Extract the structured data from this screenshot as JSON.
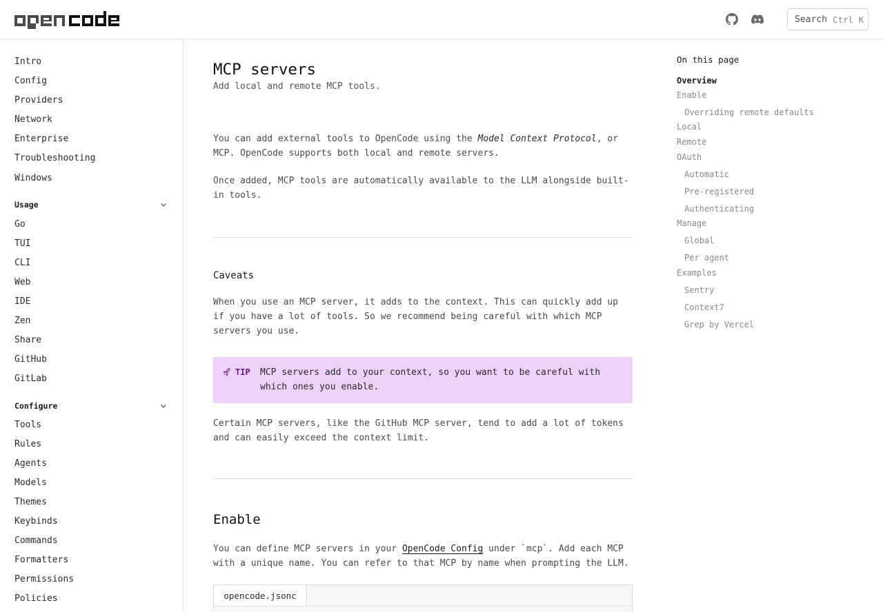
{
  "header": {
    "logo_text": "opencode",
    "search": {
      "label": "Search",
      "shortcut": "Ctrl K"
    }
  },
  "sidebar": {
    "top_items": [
      "Intro",
      "Config",
      "Providers",
      "Network",
      "Enterprise",
      "Troubleshooting",
      "Windows"
    ],
    "groups": [
      {
        "label": "Usage",
        "items": [
          "Go",
          "TUI",
          "CLI",
          "Web",
          "IDE",
          "Zen",
          "Share",
          "GitHub",
          "GitLab"
        ]
      },
      {
        "label": "Configure",
        "items": [
          "Tools",
          "Rules",
          "Agents",
          "Models",
          "Themes",
          "Keybinds",
          "Commands",
          "Formatters",
          "Permissions",
          "Policies"
        ]
      }
    ]
  },
  "main": {
    "title": "MCP servers",
    "subtitle": "Add local and remote MCP tools.",
    "intro_p1_before": "You can add external tools to OpenCode using the ",
    "intro_p1_em": "Model Context Protocol",
    "intro_p1_after": ", or MCP. OpenCode supports both local and remote servers.",
    "intro_p2": "Once added, MCP tools are automatically available to the LLM alongside built-in tools.",
    "caveats_heading": "Caveats",
    "caveats_p1": "When you use an MCP server, it adds to the context. This can quickly add up if you have a lot of tools. So we recommend being careful with which MCP servers you use.",
    "tip_label": "TIP",
    "tip_text": "MCP servers add to your context, so you want to be careful with which ones you enable.",
    "caveats_p2": "Certain MCP servers, like the GitHub MCP server, tend to add a lot of tokens and can easily exceed the context limit.",
    "enable_heading": "Enable",
    "enable_p_before": "You can define MCP servers in your ",
    "enable_p_link": "OpenCode Config",
    "enable_p_after": " under `mcp`. Add each MCP with a unique name. You can refer to that MCP by name when prompting the LLM.",
    "code_tab": "opencode.jsonc"
  },
  "toc": {
    "title": "On this page",
    "items": [
      {
        "label": "Overview",
        "indent": 0,
        "active": true
      },
      {
        "label": "Enable",
        "indent": 0,
        "active": false
      },
      {
        "label": "Overriding remote defaults",
        "indent": 1,
        "active": false
      },
      {
        "label": "Local",
        "indent": 0,
        "active": false
      },
      {
        "label": "Remote",
        "indent": 0,
        "active": false
      },
      {
        "label": "OAuth",
        "indent": 0,
        "active": false
      },
      {
        "label": "Automatic",
        "indent": 1,
        "active": false
      },
      {
        "label": "Pre-registered",
        "indent": 1,
        "active": false
      },
      {
        "label": "Authenticating",
        "indent": 1,
        "active": false
      },
      {
        "label": "Manage",
        "indent": 0,
        "active": false
      },
      {
        "label": "Global",
        "indent": 1,
        "active": false
      },
      {
        "label": "Per agent",
        "indent": 1,
        "active": false
      },
      {
        "label": "Examples",
        "indent": 0,
        "active": false
      },
      {
        "label": "Sentry",
        "indent": 1,
        "active": false
      },
      {
        "label": "Context7",
        "indent": 1,
        "active": false
      },
      {
        "label": "Grep by Vercel",
        "indent": 1,
        "active": false
      }
    ]
  },
  "icons": {
    "github": "github-icon",
    "discord": "discord-icon",
    "chevron": "chevron-down-icon",
    "tip": "rocket-icon"
  },
  "colors": {
    "tip_bg": "#edd2f7",
    "tip_accent": "#6a1a8a",
    "border": "#e2e2e2"
  }
}
